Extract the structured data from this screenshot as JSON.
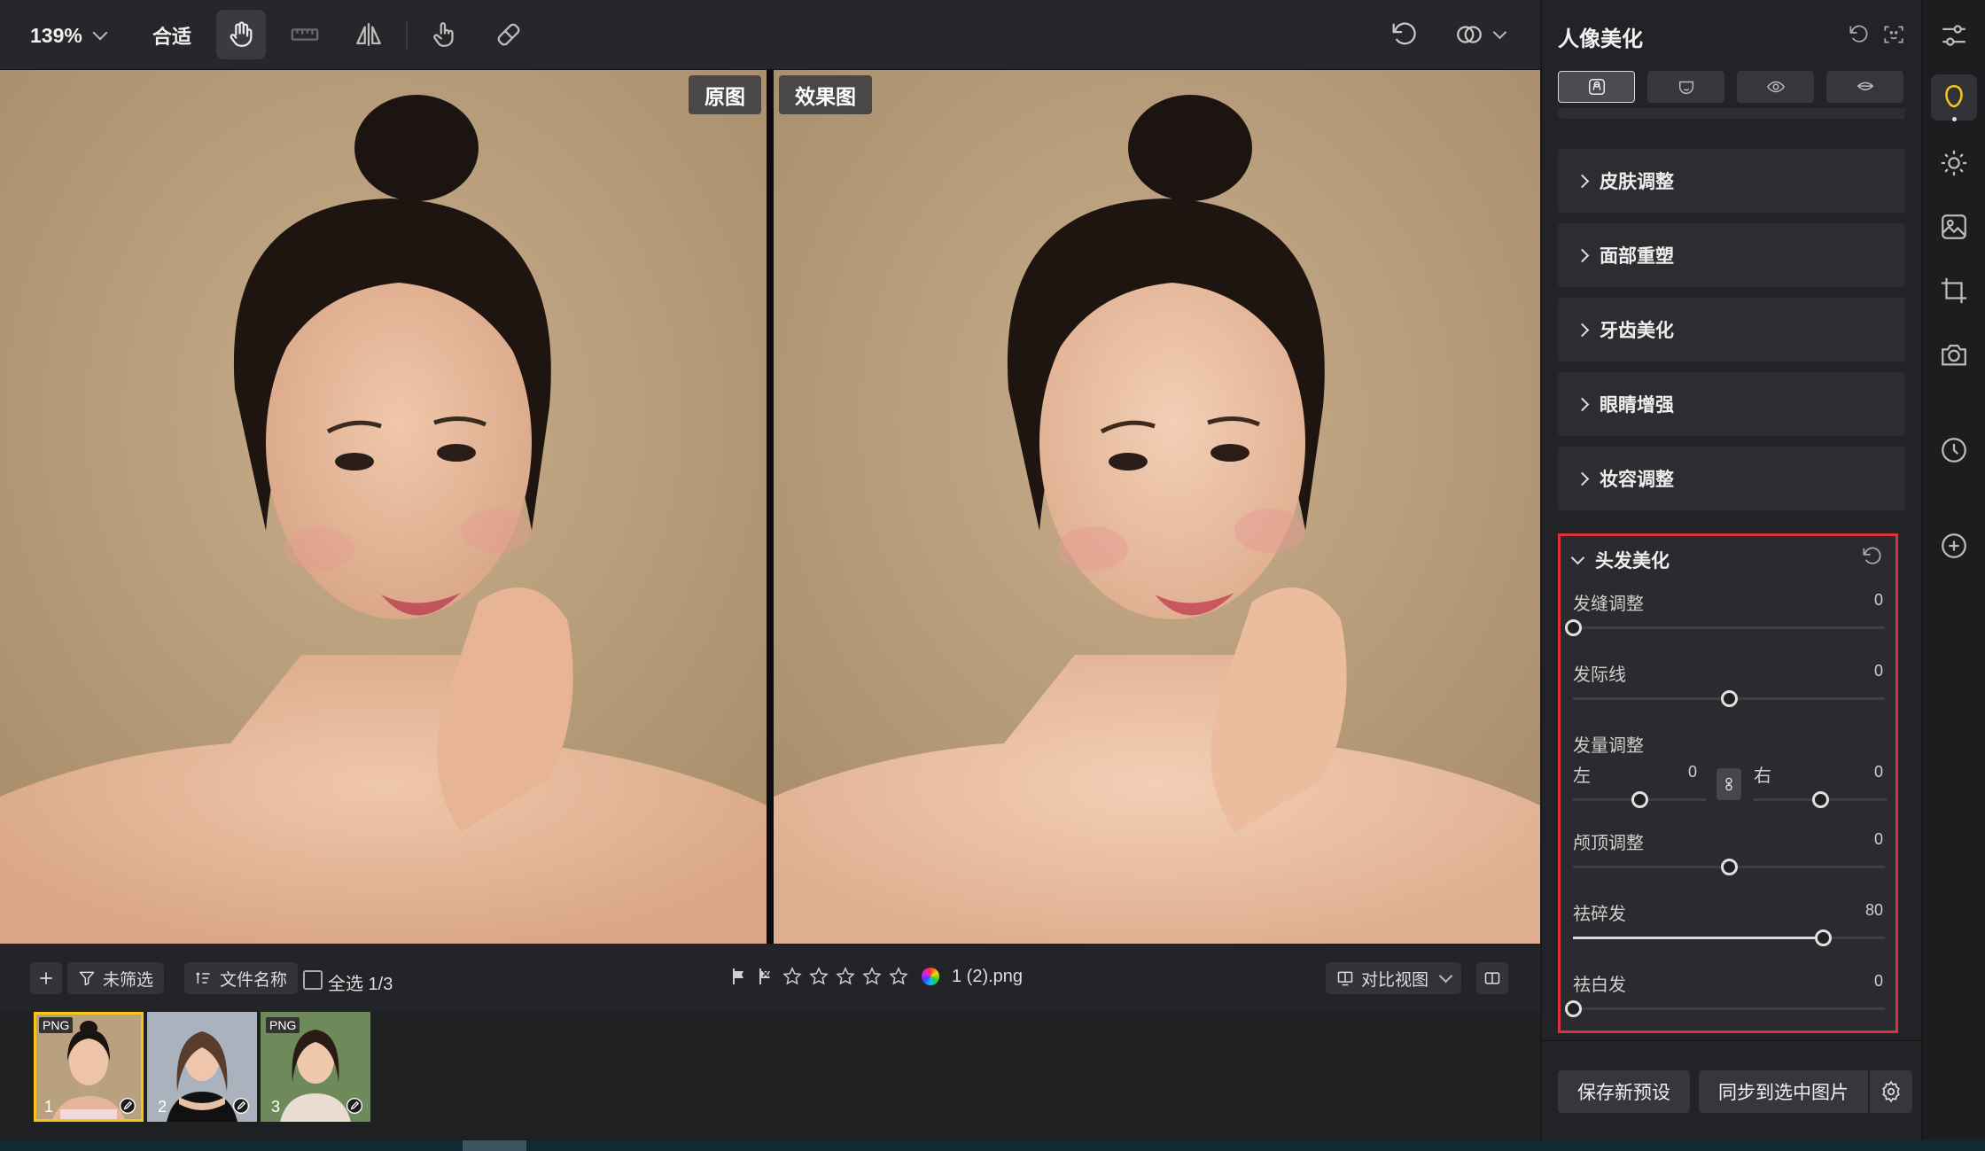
{
  "toolbar": {
    "zoom_label": "139%",
    "fit_label": "合适",
    "tools": [
      "hand-tool",
      "ruler-tool",
      "flip-tool",
      "touch-tool",
      "eraser-tool"
    ],
    "right_tools": [
      "undo-icon",
      "overlay-icon"
    ]
  },
  "viewer": {
    "original_label": "原图",
    "result_label": "效果图"
  },
  "filterbar": {
    "filter_label": "未筛选",
    "sort_label": "文件名称",
    "select_all_label": "全选 1/3",
    "filename": "1 (2).png",
    "rating_stars": 0,
    "view_mode_label": "对比视图"
  },
  "filmstrip": [
    {
      "badge": "PNG",
      "number": "1",
      "selected": true
    },
    {
      "badge": "",
      "number": "2",
      "selected": false
    },
    {
      "badge": "PNG",
      "number": "3",
      "selected": false
    }
  ],
  "panel": {
    "title": "人像美化",
    "sections": [
      "皮肤调整",
      "面部重塑",
      "牙齿美化",
      "眼睛增强",
      "妆容调整"
    ],
    "hair": {
      "title": "头发美化",
      "sliders": [
        {
          "label": "发缝调整",
          "value": "0",
          "fraction": 0.0
        },
        {
          "label": "发际线",
          "value": "0",
          "fraction": 0.5
        },
        {
          "label": "颅顶调整",
          "value": "0",
          "fraction": 0.5
        },
        {
          "label": "祛碎发",
          "value": "80",
          "fraction": 0.8
        },
        {
          "label": "祛白发",
          "value": "0",
          "fraction": 0.0
        }
      ],
      "volume": {
        "label": "发量调整",
        "left_label": "左",
        "left_value": "0",
        "left_fraction": 0.5,
        "right_label": "右",
        "right_value": "0",
        "right_fraction": 0.5
      }
    },
    "save_preset_label": "保存新预设",
    "sync_label": "同步到选中图片"
  },
  "colors": {
    "accent_selected": "#f5c518",
    "highlight_border": "#d9343b",
    "panel_bg": "#222326"
  }
}
